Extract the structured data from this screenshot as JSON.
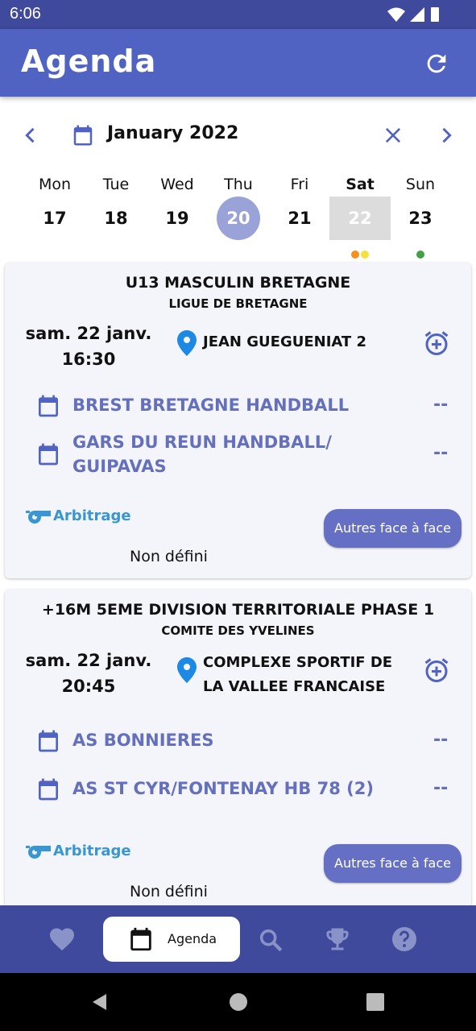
{
  "status_bar": {
    "time": "6:06"
  },
  "app_bar": {
    "title": "Agenda",
    "refresh_icon": "refresh-icon"
  },
  "calendar": {
    "month_label": "January 2022",
    "days": [
      {
        "name": "Mon",
        "num": "17"
      },
      {
        "name": "Tue",
        "num": "18"
      },
      {
        "name": "Wed",
        "num": "19"
      },
      {
        "name": "Thu",
        "num": "20",
        "state": "today"
      },
      {
        "name": "Fri",
        "num": "21"
      },
      {
        "name": "Sat",
        "num": "22",
        "state": "selected",
        "dots": [
          "#f5901e",
          "#f5e03c"
        ]
      },
      {
        "name": "Sun",
        "num": "23",
        "dots": [
          "#43a047"
        ]
      }
    ]
  },
  "matches": [
    {
      "competition": "U13 MASCULIN BRETAGNE",
      "ligue": "LIGUE DE BRETAGNE",
      "date": "sam. 22 janv.",
      "time": "16:30",
      "venue": "JEAN GUEGUENIAT 2",
      "home_team": "BREST BRETAGNE HANDBALL",
      "home_score": "--",
      "away_team": "GARS DU REUN HANDBALL/ GUIPAVAS",
      "away_score": "--",
      "referee_label": "Arbitrage",
      "referee_value": "Non défini",
      "face_button": "Autres face à face"
    },
    {
      "competition": "+16M 5EME DIVISION TERRITORIALE PHASE 1",
      "ligue": "COMITE DES YVELINES",
      "date": "sam. 22 janv.",
      "time": "20:45",
      "venue": "COMPLEXE SPORTIF DE LA VALLEE FRANCAISE",
      "home_team": "AS BONNIERES",
      "home_score": "--",
      "away_team": "AS ST CYR/FONTENAY HB 78 (2)",
      "away_score": "--",
      "referee_label": "Arbitrage",
      "referee_value": "Non défini",
      "face_button": "Autres face à face"
    }
  ],
  "bottom_nav": {
    "agenda_label": "Agenda"
  },
  "colors": {
    "primary": "#5063c3",
    "dark": "#3f4a9c",
    "accent": "#6570c4",
    "link": "#3a96d0"
  }
}
